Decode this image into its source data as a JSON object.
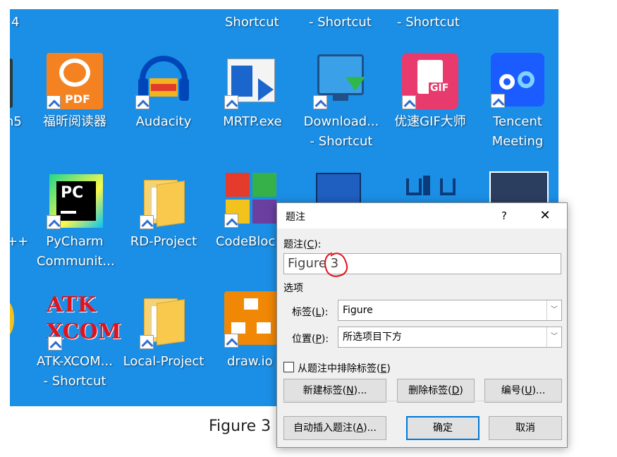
{
  "desktop": {
    "top_labels": [
      {
        "text": "4"
      },
      {
        "text": "Shortcut"
      },
      {
        "text": "- Shortcut"
      },
      {
        "text": "- Shortcut"
      }
    ],
    "row1": [
      {
        "line1": "n5",
        "line2": ""
      },
      {
        "line1": "福昕阅读器",
        "line2": ""
      },
      {
        "line1": "Audacity",
        "line2": ""
      },
      {
        "line1": "MRTP.exe",
        "line2": ""
      },
      {
        "line1": "Download...",
        "line2": "- Shortcut"
      },
      {
        "line1": "优速GIF大师",
        "line2": ""
      },
      {
        "line1": "Tencent",
        "line2": "Meeting"
      }
    ],
    "row2": [
      {
        "line1": "++",
        "line2": ""
      },
      {
        "line1": "PyCharm",
        "line2": "Communit..."
      },
      {
        "line1": "RD-Project",
        "line2": ""
      },
      {
        "line1": "CodeBloc",
        "line2": ""
      }
    ],
    "row3": [
      {
        "line1": "ATK-XCOM...",
        "line2": "- Shortcut"
      },
      {
        "line1": "Local-Project",
        "line2": ""
      },
      {
        "line1": "draw.io",
        "line2": ""
      }
    ],
    "icon_texts": {
      "pdf": "PDF",
      "gif": "GIF",
      "pc": "PC",
      "atk": "ATK",
      "xcom": "XCOM"
    }
  },
  "figure_caption": "Figure 3",
  "dialog": {
    "title": "题注",
    "help_glyph": "?",
    "close_glyph": "✕",
    "caption_label": "题注(C):",
    "caption_label_main": "题注(",
    "caption_label_key": "C",
    "caption_label_end": "):",
    "caption_value": "Figure 3",
    "options_label": "选项",
    "label_label_main": "标签(",
    "label_label_key": "L",
    "label_label_end": "):",
    "label_value": "Figure",
    "position_label_main": "位置(",
    "position_label_key": "P",
    "position_label_end": "):",
    "position_value": "所选项目下方",
    "exclude_main": "从题注中排除标签(",
    "exclude_key": "E",
    "exclude_end": ")",
    "exclude_checked": false,
    "new_label_main": "新建标签(",
    "new_label_key": "N",
    "new_label_end": ")...",
    "delete_label_main": "删除标签(",
    "delete_label_key": "D",
    "delete_label_end": ")",
    "numbering_main": "编号(",
    "numbering_key": "U",
    "numbering_end": ")...",
    "autocaption_main": "自动插入题注(",
    "autocaption_key": "A",
    "autocaption_end": ")...",
    "ok_label": "确定",
    "cancel_label": "取消",
    "dropdown_arrow": "﹀"
  },
  "colors": {
    "desktop": "#1b8fe6",
    "accent": "#0078d7",
    "annotation": "#e0121b"
  }
}
